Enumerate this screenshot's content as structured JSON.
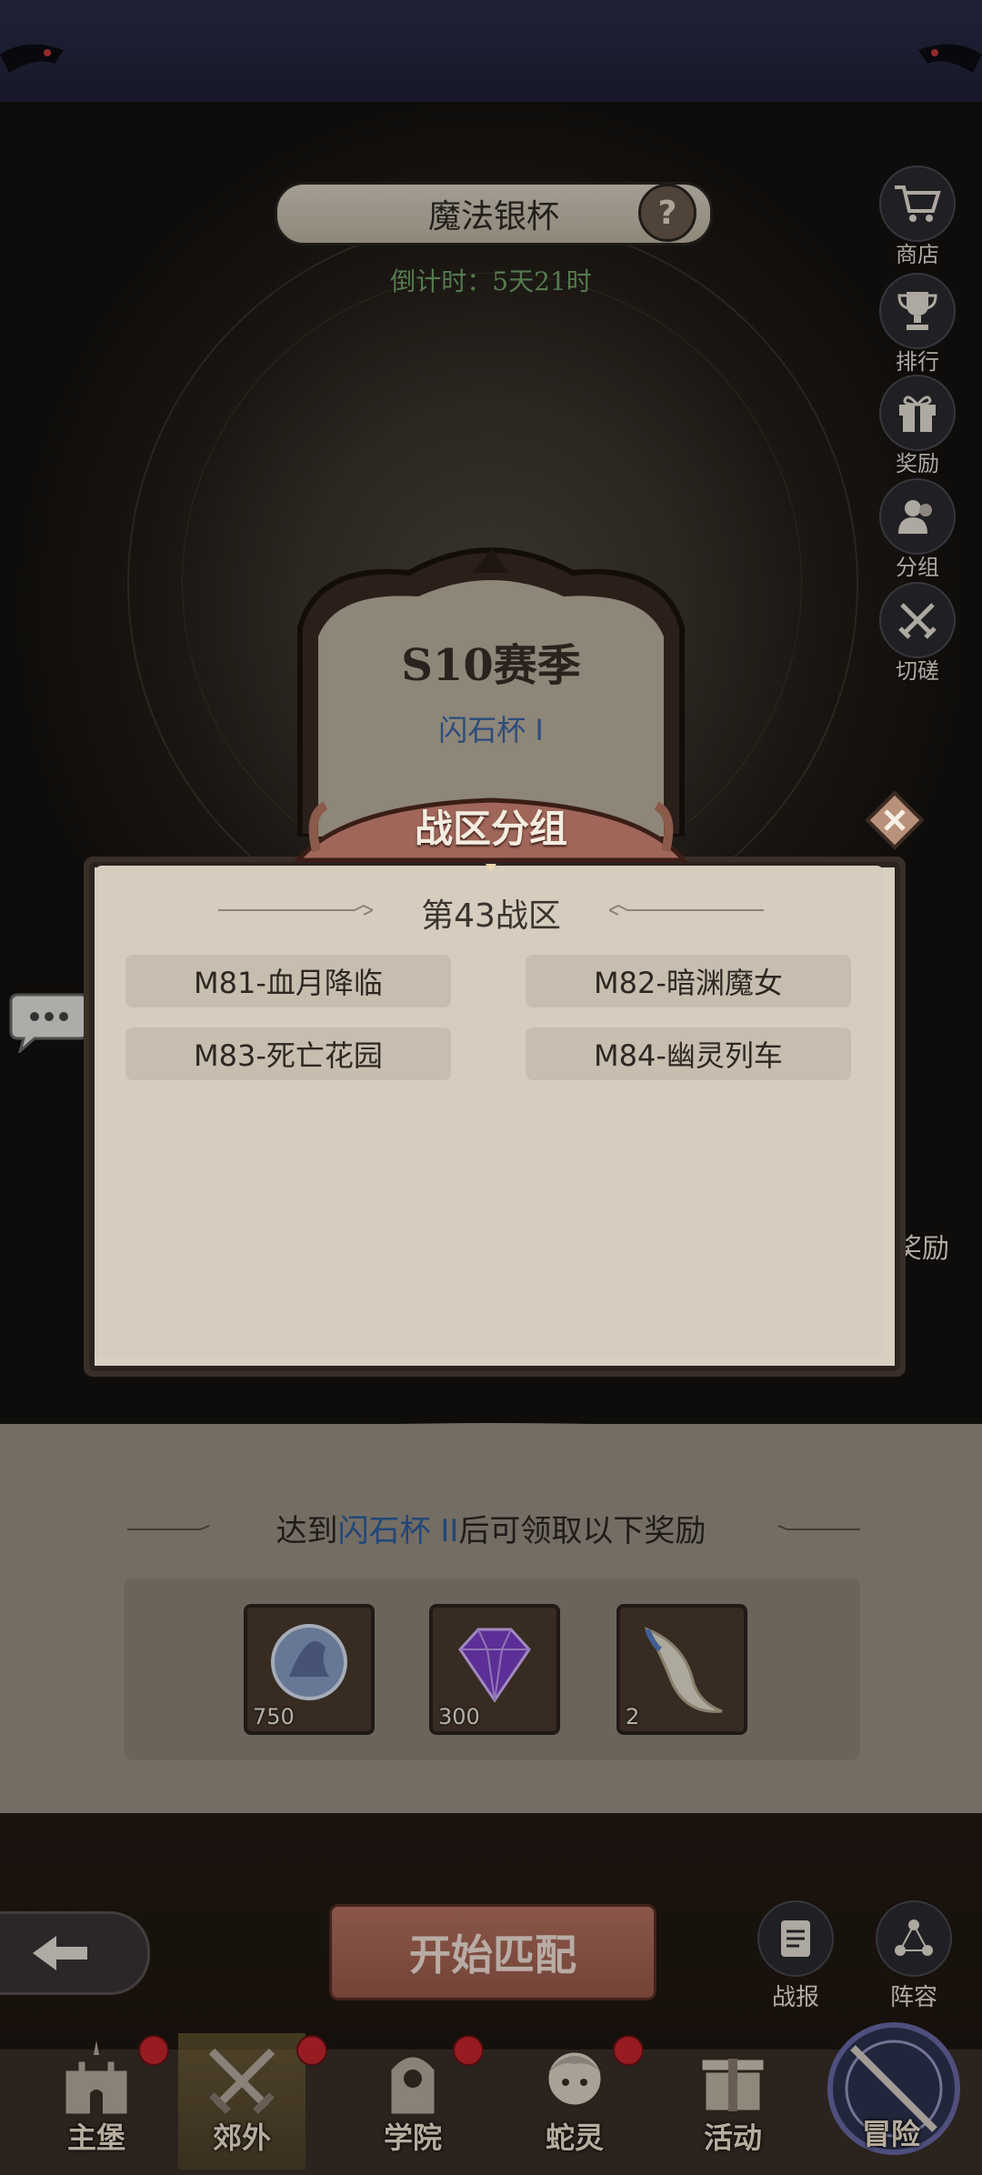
{
  "header": {
    "title": "魔法银杯",
    "help_icon": "?",
    "countdown": "倒计时：5天21时"
  },
  "side_menu": [
    {
      "icon": "cart-icon",
      "label": "商店"
    },
    {
      "icon": "trophy-icon",
      "label": "排行"
    },
    {
      "icon": "gift-icon",
      "label": "奖励"
    },
    {
      "icon": "group-icon",
      "label": "分组"
    },
    {
      "icon": "crossed-swords-icon",
      "label": "切磋"
    }
  ],
  "season": {
    "title": "S10赛季",
    "rank": "闪石杯 I"
  },
  "modal": {
    "title": "战区分组",
    "zone_heading": "第43战区",
    "zones": [
      "M81-血月降临",
      "M82-暗渊魔女",
      "M83-死亡花园",
      "M84-幽灵列车"
    ]
  },
  "partial_label": "奖励",
  "reward_banner": {
    "prefix": "达到",
    "highlight": "闪石杯 II",
    "suffix": "后可领取以下奖励"
  },
  "rewards": [
    {
      "icon": "wizard-hat-coin-icon",
      "qty": "750"
    },
    {
      "icon": "purple-gem-icon",
      "qty": "300"
    },
    {
      "icon": "fang-icon",
      "qty": "2"
    }
  ],
  "actions": {
    "start_match": "开始匹配",
    "report": "战报",
    "lineup": "阵容"
  },
  "bottom_nav": [
    {
      "label": "主堡",
      "badge": true
    },
    {
      "label": "郊外",
      "badge": true,
      "active": true
    },
    {
      "label": "学院",
      "badge": true
    },
    {
      "label": "蛇灵",
      "badge": true
    },
    {
      "label": "活动",
      "badge": false
    },
    {
      "label": "冒险",
      "badge": false
    }
  ]
}
